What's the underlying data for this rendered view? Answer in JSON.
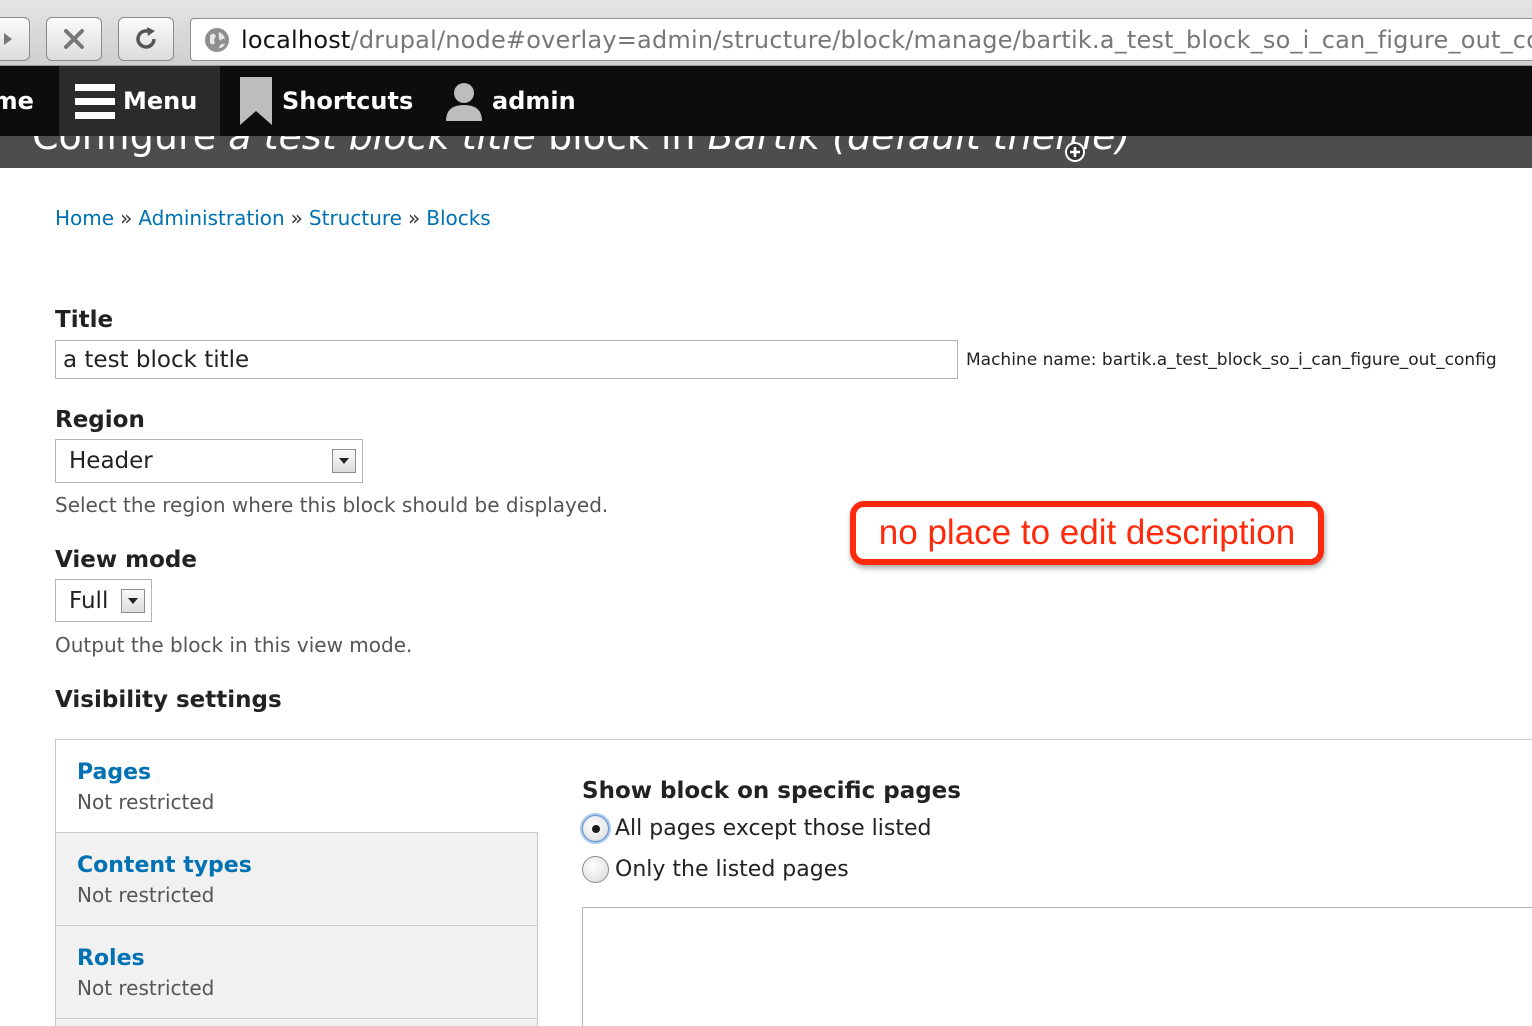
{
  "browser": {
    "url_host": "localhost",
    "url_path": "/drupal/node#overlay=admin/structure/block/manage/bartik.a_test_block_so_i_can_figure_out_config"
  },
  "toolbar": {
    "home_label": "Home",
    "menu_label": "Menu",
    "shortcuts_label": "Shortcuts",
    "user_label": "admin"
  },
  "overlay": {
    "title_prefix": "Configure ",
    "title_block": "a test block title",
    "title_middle": " block in ",
    "title_theme": "Bartik (default theme)"
  },
  "breadcrumb": {
    "items": [
      "Home",
      "Administration",
      "Structure",
      "Blocks"
    ],
    "separator": "»"
  },
  "form": {
    "title_label": "Title",
    "title_value": "a test block title",
    "machine_name": "Machine name: bartik.a_test_block_so_i_can_figure_out_config",
    "region_label": "Region",
    "region_value": "Header",
    "region_desc": "Select the region where this block should be displayed.",
    "viewmode_label": "View mode",
    "viewmode_value": "Full",
    "viewmode_desc": "Output the block in this view mode.",
    "visibility_heading": "Visibility settings"
  },
  "annotation": {
    "text": "no place to edit description",
    "color": "#ff2a0c"
  },
  "visibility_tabs": [
    {
      "title": "Pages",
      "summary": "Not restricted"
    },
    {
      "title": "Content types",
      "summary": "Not restricted"
    },
    {
      "title": "Roles",
      "summary": "Not restricted"
    }
  ],
  "pages_pane": {
    "heading": "Show block on specific pages",
    "options": [
      "All pages except those listed",
      "Only the listed pages"
    ],
    "selected": "All pages except those listed"
  },
  "colors": {
    "link": "#0071b3",
    "toolbar_bg": "#0d0d0d"
  }
}
